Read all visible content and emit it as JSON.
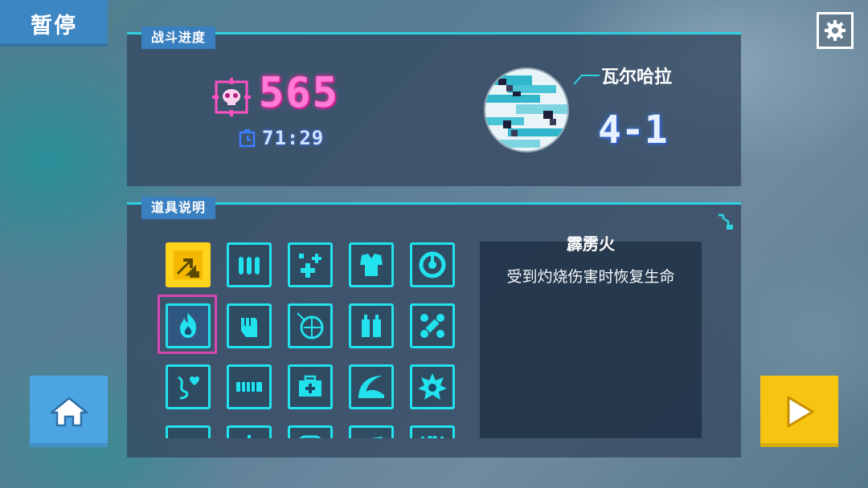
{
  "header": {
    "pause_label": "暂停"
  },
  "battle_progress": {
    "tag": "战斗进度",
    "kills": "565",
    "time": "71:29",
    "stage_name": "瓦尔哈拉",
    "stage_level": "4-1"
  },
  "items_panel": {
    "tag": "道具说明",
    "items": [
      {
        "icon": "double-arrow-icon",
        "color": "#ffd21c"
      },
      {
        "icon": "ammo-icon"
      },
      {
        "icon": "plus-cross-icon"
      },
      {
        "icon": "armor-vest-icon"
      },
      {
        "icon": "target-ring-icon"
      },
      {
        "icon": "fire-icon",
        "selected": true
      },
      {
        "icon": "fist-icon"
      },
      {
        "icon": "orb-icon"
      },
      {
        "icon": "twin-bottles-icon"
      },
      {
        "icon": "bone-icon"
      },
      {
        "icon": "heart-swirl-icon"
      },
      {
        "icon": "chain-belt-icon"
      },
      {
        "icon": "medkit-icon"
      },
      {
        "icon": "wave-icon"
      },
      {
        "icon": "spiky-bomb-icon"
      },
      {
        "icon": "helmet-icon"
      },
      {
        "icon": "sparkle-icon"
      },
      {
        "icon": "shield-frame-icon"
      },
      {
        "icon": "boot-icon"
      },
      {
        "icon": "heart-hands-icon"
      }
    ],
    "selected_name": "霹雳火",
    "selected_description": "受到灼烧伤害时恢复生命"
  },
  "colors": {
    "accent": "#2ed1df",
    "score": "#ff7bd6",
    "gold": "#ffd21c",
    "select": "#d846b0"
  }
}
